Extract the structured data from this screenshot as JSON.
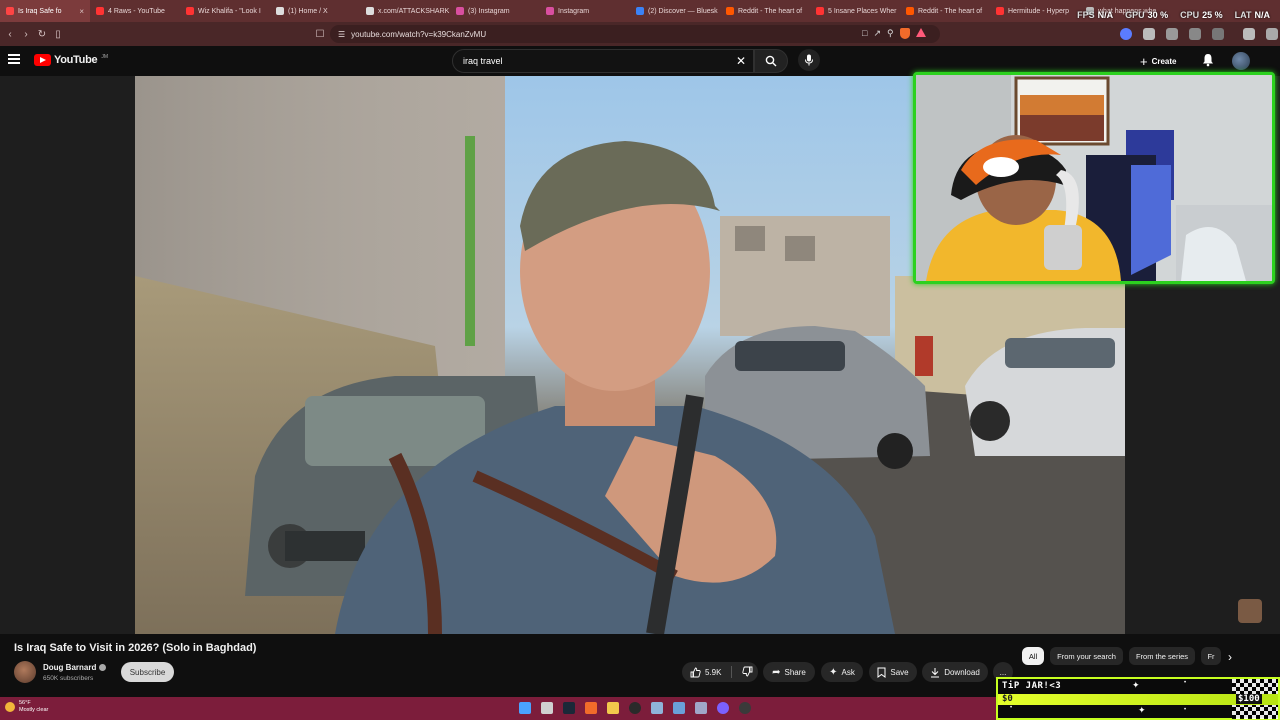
{
  "browser": {
    "tabs": [
      {
        "label": "Is Iraq Safe fo",
        "color": "#ff4444",
        "active": true
      },
      {
        "label": "4 Raws - YouTube",
        "color": "#ff3333"
      },
      {
        "label": "Wiz Khalifa - \"Look I",
        "color": "#ff3333"
      },
      {
        "label": "(1) Home / X",
        "color": "#dddddd"
      },
      {
        "label": "x.com/ATTACKSHARK",
        "color": "#dddddd"
      },
      {
        "label": "(3) Instagram",
        "color": "#d94fa0"
      },
      {
        "label": "Instagram",
        "color": "#d94fa0"
      },
      {
        "label": "(2) Discover — Bluesk",
        "color": "#3b82f6"
      },
      {
        "label": "Reddit - The heart of",
        "color": "#ff5700"
      },
      {
        "label": "5 Insane Places Wher",
        "color": "#ff3333"
      },
      {
        "label": "Reddit - The heart of",
        "color": "#ff5700"
      },
      {
        "label": "Hermitude - Hyperp",
        "color": "#ff3333"
      },
      {
        "label": "what happens whe",
        "color": "#bbbbbb"
      }
    ],
    "url": "youtube.com/watch?v=k39CkanZvMU"
  },
  "perf": {
    "fps_label": "FPS",
    "fps_value": "N/A",
    "gpu_label": "GPU",
    "gpu_value": "30 %",
    "cpu_label": "CPU",
    "cpu_value": "25 %",
    "lat_label": "LAT",
    "lat_value": "N/A"
  },
  "youtube": {
    "logo_text": "YouTube",
    "logo_sup": "JM",
    "search_value": "iraq travel",
    "create_label": "Create"
  },
  "video": {
    "title": "Is Iraq Safe to Visit in 2026? (Solo in Baghdad)",
    "channel_name": "Doug Barnard",
    "subscribers": "650K subscribers",
    "subscribe_label": "Subscribe",
    "likes": "5.9K",
    "share_label": "Share",
    "ask_label": "Ask",
    "save_label": "Save",
    "download_label": "Download",
    "more_label": "..."
  },
  "chips": [
    "All",
    "From your search",
    "From the series",
    "Fr"
  ],
  "taskbar": {
    "weather_temp": "56°F",
    "weather_desc": "Mostly clear"
  },
  "tipjar": {
    "title": "TiP JAR!<3",
    "current": "$0",
    "goal": "$100",
    "progress_fraction": 0
  }
}
